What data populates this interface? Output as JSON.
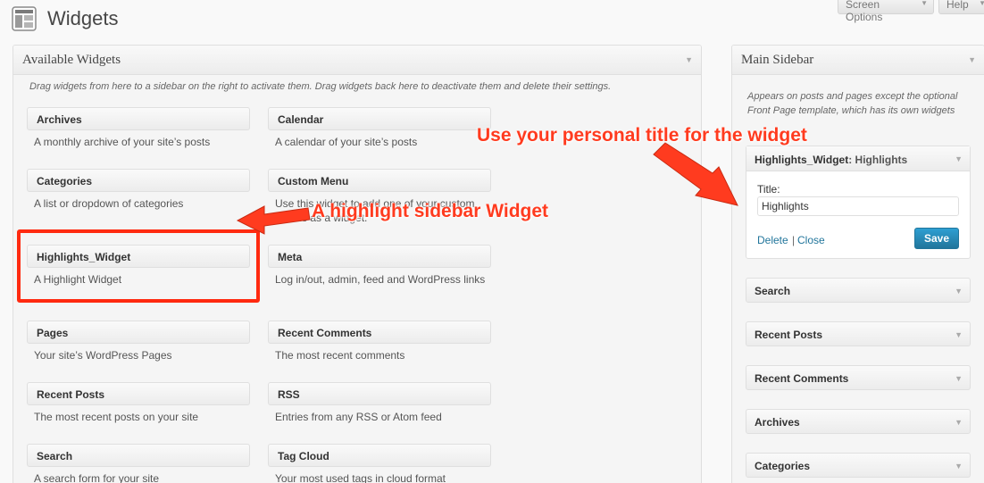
{
  "header": {
    "title": "Widgets",
    "screen_options": "Screen Options",
    "help": "Help"
  },
  "available": {
    "title": "Available Widgets",
    "description": "Drag widgets from here to a sidebar on the right to activate them. Drag widgets back here to deactivate them and delete their settings.",
    "widgets": [
      {
        "title": "Archives",
        "desc": "A monthly archive of your site’s posts"
      },
      {
        "title": "Calendar",
        "desc": "A calendar of your site’s posts"
      },
      {
        "title": "Categories",
        "desc": "A list or dropdown of categories"
      },
      {
        "title": "Custom Menu",
        "desc": "Use this widget to add one of your custom menus as a widget."
      },
      {
        "title": "Highlights_Widget",
        "desc": "A Highlight Widget"
      },
      {
        "title": "Meta",
        "desc": "Log in/out, admin, feed and WordPress links"
      },
      {
        "title": "Pages",
        "desc": "Your site’s WordPress Pages"
      },
      {
        "title": "Recent Comments",
        "desc": "The most recent comments"
      },
      {
        "title": "Recent Posts",
        "desc": "The most recent posts on your site"
      },
      {
        "title": "RSS",
        "desc": "Entries from any RSS or Atom feed"
      },
      {
        "title": "Search",
        "desc": "A search form for your site"
      },
      {
        "title": "Tag Cloud",
        "desc": "Your most used tags in cloud format"
      }
    ]
  },
  "sidebar": {
    "title": "Main Sidebar",
    "description": "Appears on posts and pages except the optional Front Page template, which has its own widgets",
    "open_widget": {
      "name": "Highlights_Widget",
      "subtitle": ": Highlights",
      "title_label": "Title:",
      "title_value": "Highlights",
      "delete_label": "Delete",
      "separator": "|",
      "close_label": "Close",
      "save_label": "Save"
    },
    "widgets": [
      "Search",
      "Recent Posts",
      "Recent Comments",
      "Archives",
      "Categories"
    ]
  },
  "annotations": {
    "title_note": "Use your personal title for the widget",
    "widget_note": "A highlight sidebar Widget",
    "color": "#ff3b1f"
  }
}
